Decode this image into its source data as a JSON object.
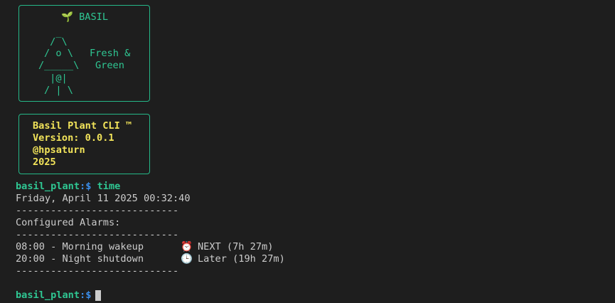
{
  "logo": {
    "title": "🌱 BASIL",
    "art": [
      "  _",
      " / \\",
      "/ o \\",
      "/_____\\",
      " |@|",
      "/ | \\"
    ],
    "tagline": [
      "Fresh &",
      "Green"
    ]
  },
  "info": {
    "lines": [
      "Basil Plant CLI ™",
      "Version: 0.0.1",
      "@hpsaturn",
      "2025"
    ]
  },
  "terminal": {
    "prompt_user": "basil_plant",
    "prompt_symbol": ":$",
    "command": "time",
    "datetime": "Friday, April 11 2025 00:32:40",
    "separator": "----------------------------",
    "alarms_header": "Configured Alarms:",
    "alarms": [
      {
        "entry": "08:00 - Morning wakeup",
        "icon": "⏰",
        "status": "NEXT (7h 27m)"
      },
      {
        "entry": "20:00 - Night shutdown",
        "icon": "🕒",
        "status": "Later (19h 27m)"
      }
    ]
  }
}
